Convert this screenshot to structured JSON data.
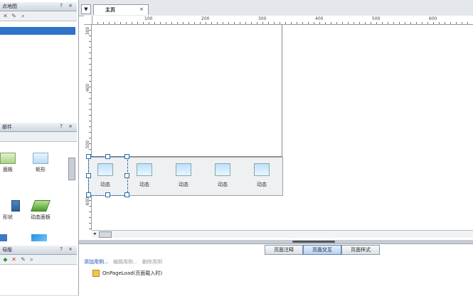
{
  "left_panel": {
    "sitemap_title": "点地图",
    "sitemap_controls": "? ×",
    "widgets_title": "部件",
    "widgets_controls": "? ×",
    "widget_items": [
      {
        "label": "面板",
        "icon": "panel-icon"
      },
      {
        "label": "矩形",
        "icon": "rectangle-icon"
      },
      {
        "label": "形状",
        "icon": "shape-icon"
      },
      {
        "label": "动态面板",
        "icon": "dynamic-panel-icon"
      }
    ],
    "masters_title": "母版",
    "masters_controls": "? ×"
  },
  "editor": {
    "tab_label": "主页",
    "ruler_top": [
      "100",
      "200",
      "300",
      "400",
      "500",
      "600"
    ],
    "ruler_left": [
      "300",
      "400",
      "500",
      "600"
    ],
    "dynamic_items": [
      "动态",
      "动态",
      "动态",
      "动态",
      "动态"
    ]
  },
  "bottom": {
    "tabs": [
      "页面注释",
      "页面交互",
      "页面样式"
    ],
    "add_case": "添加用例...",
    "edit_case": "编辑用例...",
    "delete_case": "删除用例",
    "event": "OnPageLoad(页面载入时)"
  }
}
